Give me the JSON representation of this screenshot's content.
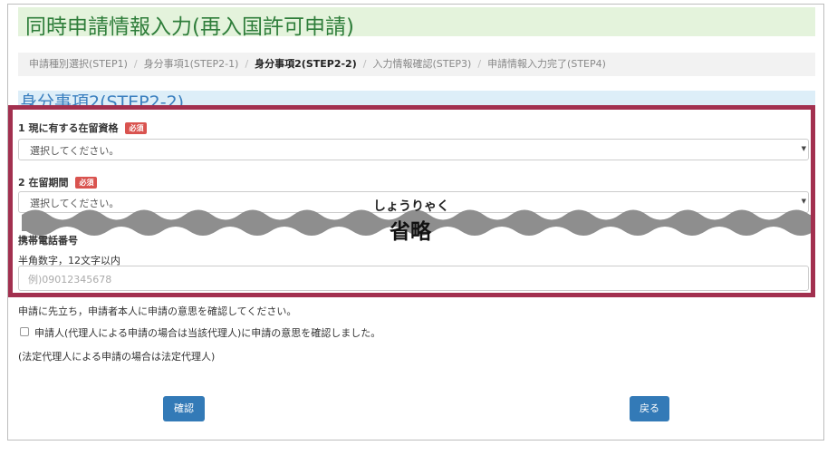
{
  "page": {
    "title": "同時申請情報入力(再入国許可申請)"
  },
  "breadcrumb": [
    {
      "label": "申請種別選択(STEP1)",
      "active": false
    },
    {
      "label": "身分事項1(STEP2-1)",
      "active": false
    },
    {
      "label": "身分事項2(STEP2-2)",
      "active": true
    },
    {
      "label": "入力情報確認(STEP3)",
      "active": false
    },
    {
      "label": "申請情報入力完了(STEP4)",
      "active": false
    }
  ],
  "section": {
    "title": "身分事項2(STEP2-2)"
  },
  "form": {
    "status_label": "1 現に有する在留資格",
    "required_badge": "必須",
    "status_select": "選択してください。",
    "period_label": "2 在留期間",
    "period_select": "選択してください。",
    "phone_label": "携帯電話番号",
    "phone_hint": "半角数字，12文字以内",
    "phone_placeholder": "例)09012345678"
  },
  "omission": {
    "ruby": "しょうりゃく",
    "text": "省略"
  },
  "consent": {
    "note": "申請に先立ち，申請者本人に申請の意思を確認してください。",
    "checkbox_label": "申請人(代理人による申請の場合は当該代理人)に申請の意思を確認しました。",
    "legal_note": "(法定代理人による申請の場合は法定代理人)"
  },
  "buttons": {
    "confirm": "確認",
    "back": "戻る"
  },
  "colors": {
    "highlight_border": "#a2304f",
    "title_bg": "#e4f3dc",
    "button": "#337ab7",
    "required_badge": "#d9534f"
  },
  "icons": {
    "select_arrow": "caret-down-icon"
  }
}
